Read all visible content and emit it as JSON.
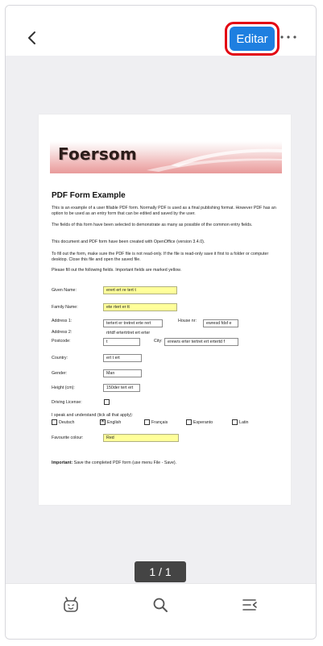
{
  "toolbar": {
    "back_icon": "chevron-left-icon",
    "edit_label": "Editar",
    "more_icon": "more-horizontal-icon",
    "accent_color": "#1e7fe0",
    "highlight_color": "#e30613"
  },
  "document": {
    "brand": "Foersom",
    "title": "PDF Form Example",
    "paragraphs": [
      "This is an example of a user fillable PDF form. Normally PDF is used as a final publishing format. However PDF has an option to be used as an entry form that can be edited and saved by the user.",
      "The fields of this form have been selected to demonstrate as many as possible of the common entry fields.",
      "This document and PDF form have been created with OpenOffice (version 3.4.0).",
      "To fill out the form, make sure the PDF file is not read-only. If the file is read-only save it first to a folder or computer desktop. Close this file and open the saved file.",
      "Please fill out the following fields. Important fields are marked yellow."
    ],
    "fields": {
      "given_name_label": "Given Name:",
      "given_name_value": "erert ert re tert t",
      "family_name_label": "Family Name:",
      "family_name_value": "ete rtert er tt",
      "address1_label": "Address 1:",
      "address1_value": "tertert er tretret  erte rert",
      "house_nr_label": "House nr:",
      "house_nr_value": "ewresd fdsf e",
      "address2_label": "Address 2:",
      "address2_value": "rtrtdf ertertrtret ert erter",
      "postcode_label": "Postcode:",
      "postcode_value": "t",
      "city_label": "City:",
      "city_value": "erewrs erter tertret ert ertertd f",
      "country_label": "Country:",
      "country_value": "ert t ert",
      "gender_label": "Gender:",
      "gender_value": "Man",
      "height_label": "Height (cm):",
      "height_value": "150der tert ert",
      "driving_label": "Driving License:",
      "languages_label": "I speak and understand (tick all that apply):",
      "lang_deutsch": "Deutsch",
      "lang_english": "English",
      "lang_francais": "Français",
      "lang_esperanto": "Esperanto",
      "lang_latin": "Latin",
      "english_mark": "✕",
      "colour_label": "Favourite colour:",
      "colour_value": "Red"
    },
    "important_label": "Important:",
    "important_text": " Save the completed PDF form (use menu File - Save)."
  },
  "page_indicator": "1 / 1",
  "bottom_bar": {
    "icons": [
      "bot-face-icon",
      "search-icon",
      "outline-list-icon"
    ]
  }
}
